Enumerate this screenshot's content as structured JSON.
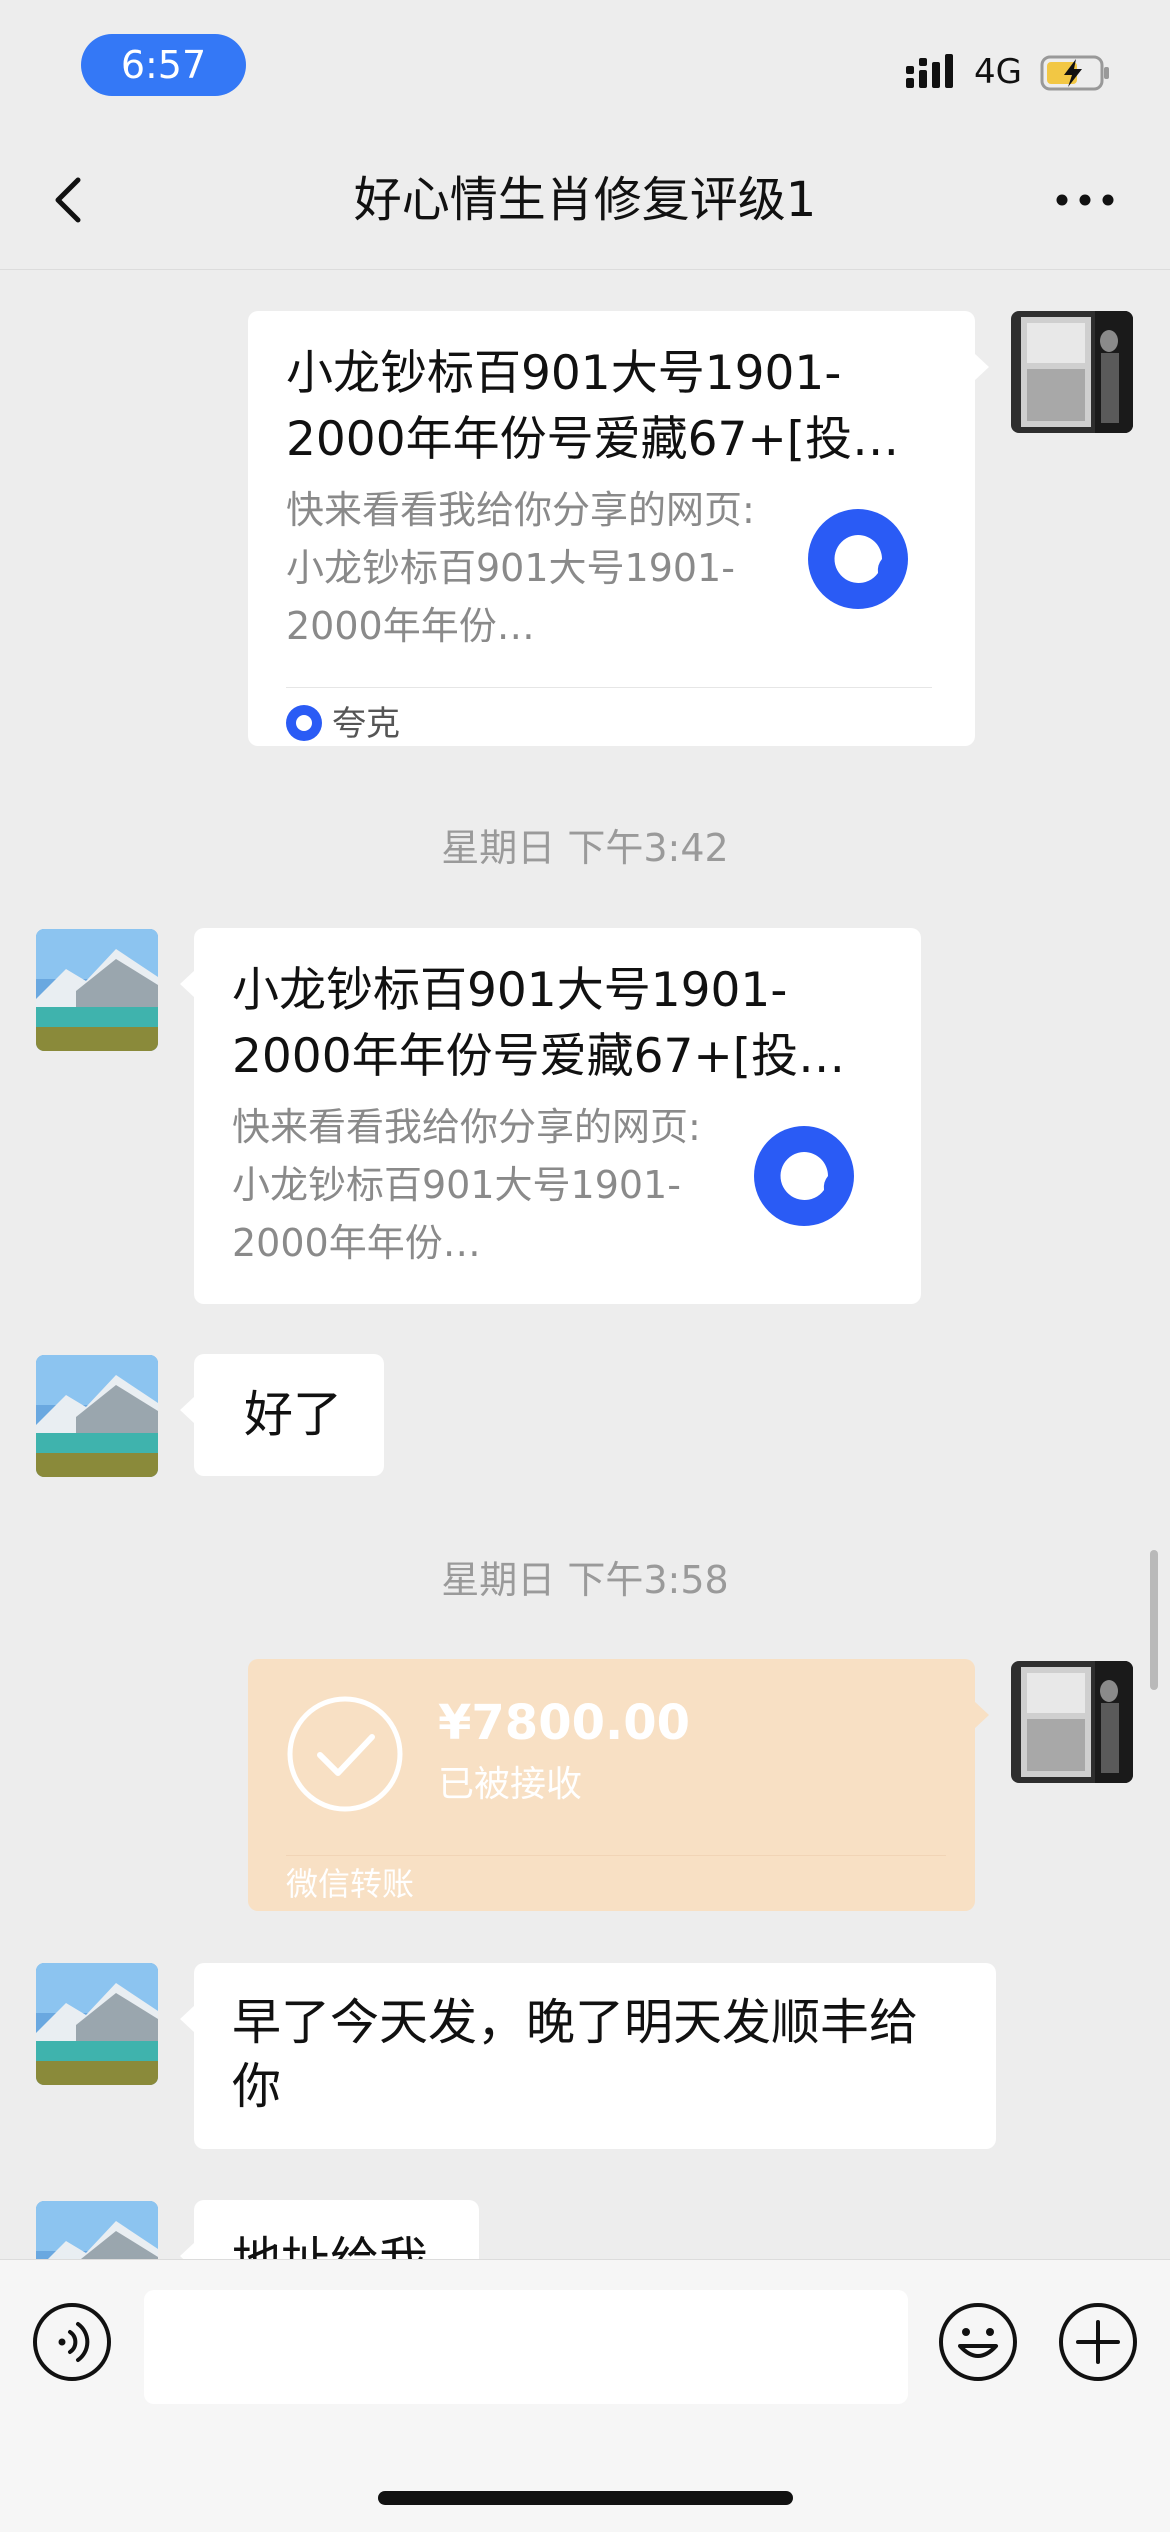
{
  "status_bar": {
    "time": "6:57",
    "network": "4G",
    "signal_icon": "signal-bars-icon",
    "battery_icon": "battery-charging-icon"
  },
  "nav": {
    "title": "好心情生肖修复评级1",
    "back_icon": "chevron-left-icon",
    "more_icon": "more-dots-icon"
  },
  "messages": [
    {
      "type": "link",
      "from": "me",
      "title": "小龙钞标百901大号1901-2000年年份号爱藏67+[投…",
      "desc": "快来看看我给你分享的网页:小龙钞标百901大号1901-2000年年份…",
      "source": "夸克",
      "icon": "quark-icon"
    },
    {
      "type": "time",
      "text": "星期日 下午3:42"
    },
    {
      "type": "link",
      "from": "other",
      "title": "小龙钞标百901大号1901-2000年年份号爱藏67+[投…",
      "desc": "快来看看我给你分享的网页:小龙钞标百901大号1901-2000年年份…",
      "icon": "quark-icon"
    },
    {
      "type": "text",
      "from": "other",
      "text": "好了"
    },
    {
      "type": "time",
      "text": "星期日 下午3:58"
    },
    {
      "type": "transfer",
      "from": "me",
      "amount": "¥7800.00",
      "status": "已被接收",
      "footer": "微信转账"
    },
    {
      "type": "text",
      "from": "other",
      "text": "早了今天发，晚了明天发顺丰给你"
    },
    {
      "type": "text",
      "from": "other",
      "text": "地址给我"
    }
  ],
  "input_bar": {
    "voice_icon": "voice-icon",
    "emoji_icon": "emoji-icon",
    "plus_icon": "plus-circle-icon",
    "input_value": ""
  },
  "colors": {
    "accent": "#3478f6",
    "background": "#ededed",
    "transfer": "#f8e0c4",
    "quark": "#2a5bf5"
  }
}
